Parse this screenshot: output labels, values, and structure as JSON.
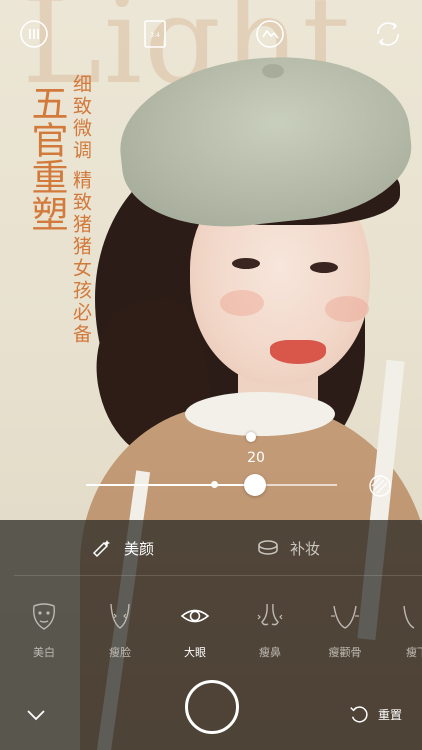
{
  "background": {
    "word": "Light"
  },
  "promo": {
    "title": "五官重塑",
    "line1": "细致微调",
    "line2": "精致猪猪女孩必备"
  },
  "topbar": {
    "icons": [
      "menu-dots-icon",
      "aspect-ratio-icon",
      "face-effect-icon",
      "switch-camera-icon"
    ]
  },
  "slider": {
    "value": "20",
    "fill_fraction": 0.68
  },
  "tabs": [
    {
      "label": "美颜",
      "icon": "magic-brush-icon",
      "selected": true
    },
    {
      "label": "补妆",
      "icon": "compact-icon",
      "selected": false
    }
  ],
  "tools": [
    {
      "label": "美白",
      "icon": "face-mask-icon",
      "selected": false
    },
    {
      "label": "瘦脸",
      "icon": "face-contour-icon",
      "selected": false
    },
    {
      "label": "大眼",
      "icon": "eye-icon",
      "selected": true
    },
    {
      "label": "瘦鼻",
      "icon": "nose-icon",
      "selected": false
    },
    {
      "label": "瘦颧骨",
      "icon": "cheekbone-icon",
      "selected": false
    },
    {
      "label": "瘦下",
      "icon": "chin-icon",
      "selected": false
    }
  ],
  "bottom": {
    "reset_label": "重置"
  },
  "colors": {
    "accent_promo": "#d27a3c",
    "panel_bg": "rgba(42,40,36,0.74)"
  }
}
